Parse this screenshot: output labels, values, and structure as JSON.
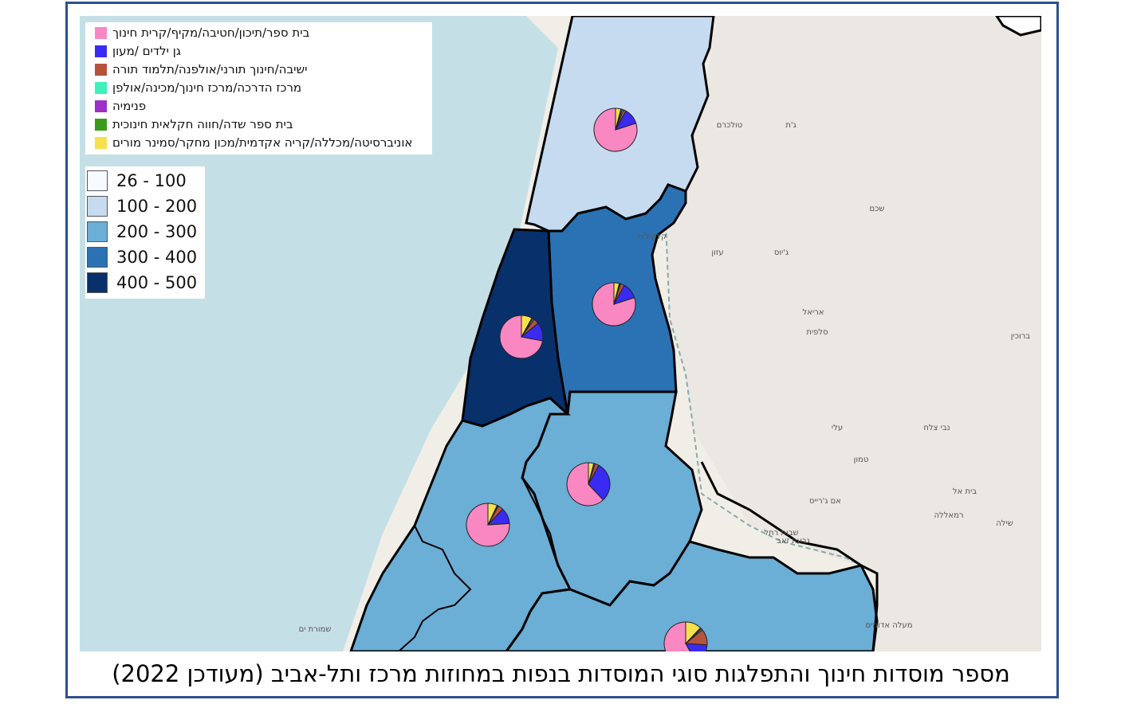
{
  "caption": "מספר מוסדות חינוך והתפלגות סוגי המוסדות בנפות במחוזות מרכז ותל-אביב (מעודכן 2022)",
  "colors": {
    "sea": "#c5dfe6",
    "land": "#f2efe9",
    "frame": "#2f4f8f",
    "school": "#f987c2",
    "kindergarten": "#3a2bf2",
    "yeshiva": "#b5533c",
    "center": "#3ff0b8",
    "dormitory": "#9b2fc6",
    "field": "#3a9a1a",
    "university": "#f5e14c"
  },
  "legend_types": [
    {
      "label": "בית ספר/תיכון/חטיבה/מקיף/קרית חינוך",
      "color": "#f987c2"
    },
    {
      "label": "גן ילדים /מעון",
      "color": "#3a2bf2"
    },
    {
      "label": "ישיבה/חינוך תורני/אולפנה/תלמוד תורה",
      "color": "#b5533c"
    },
    {
      "label": "מרכז הדרכה/מרכז חינוך/מכינה/אולפן",
      "color": "#3ff0b8"
    },
    {
      "label": "פנימיה",
      "color": "#9b2fc6"
    },
    {
      "label": "בית ספר שדה/חווה חקלאית חינוכית",
      "color": "#3a9a1a"
    },
    {
      "label": "אוניברסיטה/מכללה/קריה אקדמית/מכון מחקר/סמינר מורים",
      "color": "#f5e14c"
    }
  ],
  "legend_ranges": [
    {
      "label": "26 - 100",
      "color": "#f7fbff"
    },
    {
      "label": "100 - 200",
      "color": "#c6dbef"
    },
    {
      "label": "200 - 300",
      "color": "#6baed6"
    },
    {
      "label": "300 - 400",
      "color": "#2b72b5"
    },
    {
      "label": "400 - 500",
      "color": "#08306b"
    }
  ],
  "map_labels": [
    {
      "text": "ג'ת"
    },
    {
      "text": "טולכרם"
    },
    {
      "text": "קלקיליה"
    },
    {
      "text": "שכם"
    },
    {
      "text": "עזון"
    },
    {
      "text": "ג'יוס"
    },
    {
      "text": "אריאל"
    },
    {
      "text": "סלפית"
    },
    {
      "text": "אם ג'רייס"
    },
    {
      "text": "שבות רחל"
    },
    {
      "text": "עלי"
    },
    {
      "text": "טמון"
    },
    {
      "text": "נבי צלח"
    },
    {
      "text": "בית אל"
    },
    {
      "text": "רמאללה"
    },
    {
      "text": "שילה"
    },
    {
      "text": "גבעת זאב"
    },
    {
      "text": "מעלה אדומים"
    },
    {
      "text": "שמורת ים"
    },
    {
      "text": "ברוכין"
    }
  ],
  "districts": [
    {
      "name": "sharon-north",
      "range": "100 - 200",
      "pie": [
        0.8,
        0.12,
        0.02,
        0.01,
        0.01,
        0.0,
        0.04
      ]
    },
    {
      "name": "petah-tikva",
      "range": "300 - 400",
      "pie": [
        0.8,
        0.12,
        0.03,
        0.005,
        0.005,
        0.0,
        0.04
      ]
    },
    {
      "name": "tel-aviv",
      "range": "400 - 500",
      "pie": [
        0.72,
        0.14,
        0.04,
        0.01,
        0.01,
        0.0,
        0.08
      ]
    },
    {
      "name": "ramla",
      "range": "200 - 300",
      "pie": [
        0.62,
        0.3,
        0.03,
        0.0,
        0.01,
        0.0,
        0.04
      ]
    },
    {
      "name": "rishon-holon",
      "range": "200 - 300",
      "pie": [
        0.76,
        0.12,
        0.04,
        0.005,
        0.005,
        0.0,
        0.07
      ]
    },
    {
      "name": "rehovot",
      "range": "200 - 300",
      "pie": [
        0.58,
        0.16,
        0.12,
        0.01,
        0.01,
        0.0,
        0.12
      ]
    }
  ]
}
